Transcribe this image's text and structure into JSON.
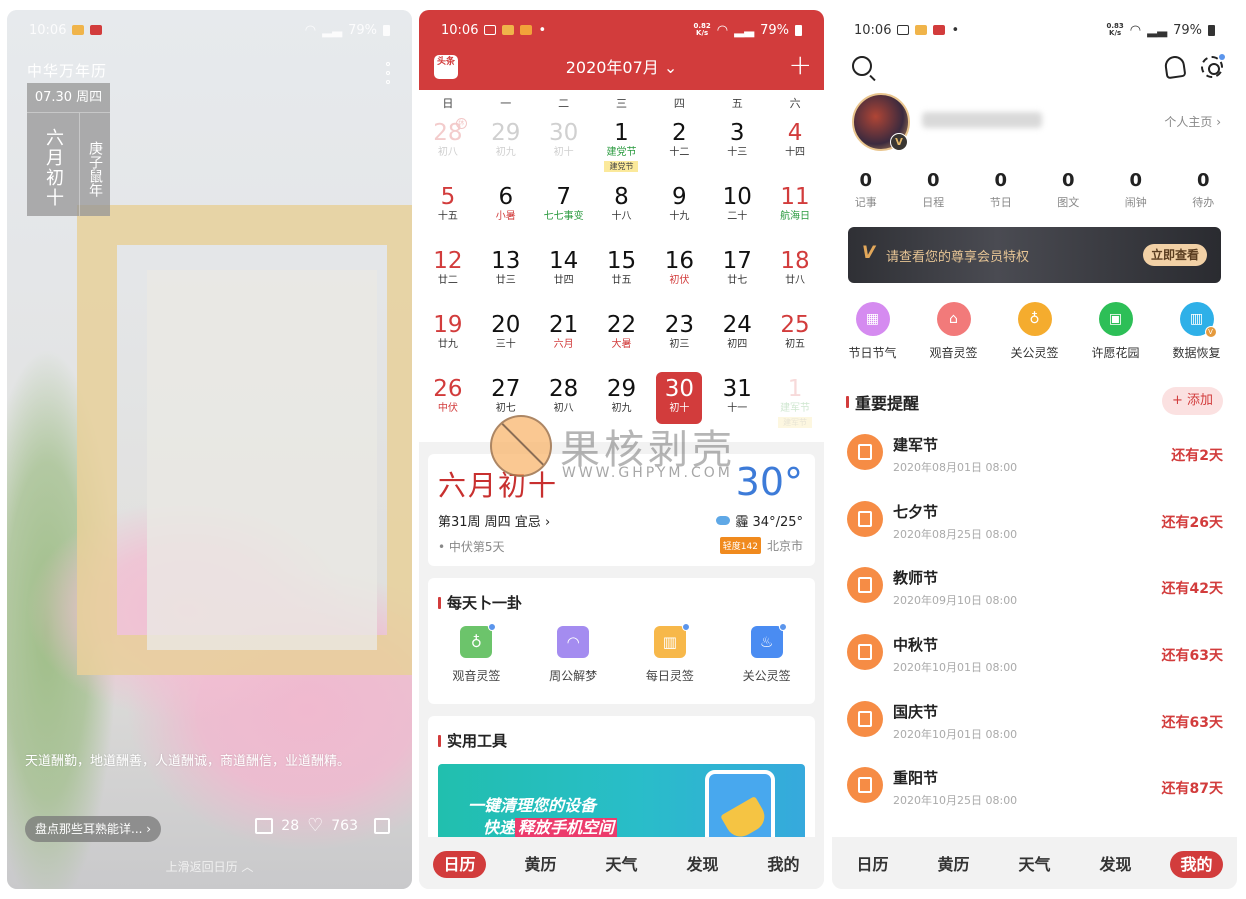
{
  "screen1": {
    "status": {
      "time": "10:06",
      "battery": "79%"
    },
    "app_name": "中华万年历",
    "date_card": {
      "date": "07.30 周四",
      "lunar": "六月初十",
      "year": "庚子鼠年"
    },
    "quote": "天道酬勤，地道酬善，人道酬诚，商道酬信，业道酬精。",
    "article_link": "盘点那些耳熟能详... ›",
    "comments": "28",
    "likes": "763",
    "swipe_hint": "上滑返回日历 ︿"
  },
  "screen2": {
    "status": {
      "time": "10:06",
      "speed": "0.82\nK/s",
      "battery": "79%"
    },
    "logo": "头条",
    "month_title": "2020年07月 ⌄",
    "add_label": "+",
    "weekdays": [
      "日",
      "一",
      "二",
      "三",
      "四",
      "五",
      "六"
    ],
    "days": [
      {
        "num": "28",
        "sub": "初八",
        "cls": "other wk",
        "badge": "休"
      },
      {
        "num": "29",
        "sub": "初九",
        "cls": "other"
      },
      {
        "num": "30",
        "sub": "初十",
        "cls": "other"
      },
      {
        "num": "1",
        "sub": "建党节",
        "subcls": "green",
        "tag": "建党节"
      },
      {
        "num": "2",
        "sub": "十二"
      },
      {
        "num": "3",
        "sub": "十三"
      },
      {
        "num": "4",
        "sub": "十四",
        "cls": "wk"
      },
      {
        "num": "5",
        "sub": "十五",
        "cls": "wk"
      },
      {
        "num": "6",
        "sub": "小暑",
        "subcls": "red"
      },
      {
        "num": "7",
        "sub": "七七事变",
        "subcls": "green"
      },
      {
        "num": "8",
        "sub": "十八"
      },
      {
        "num": "9",
        "sub": "十九"
      },
      {
        "num": "10",
        "sub": "二十"
      },
      {
        "num": "11",
        "sub": "航海日",
        "cls": "wk",
        "subcls": "green"
      },
      {
        "num": "12",
        "sub": "廿二",
        "cls": "wk"
      },
      {
        "num": "13",
        "sub": "廿三"
      },
      {
        "num": "14",
        "sub": "廿四"
      },
      {
        "num": "15",
        "sub": "廿五"
      },
      {
        "num": "16",
        "sub": "初伏",
        "subcls": "red"
      },
      {
        "num": "17",
        "sub": "廿七"
      },
      {
        "num": "18",
        "sub": "廿八",
        "cls": "wk"
      },
      {
        "num": "19",
        "sub": "廿九",
        "cls": "wk"
      },
      {
        "num": "20",
        "sub": "三十"
      },
      {
        "num": "21",
        "sub": "六月",
        "subcls": "red"
      },
      {
        "num": "22",
        "sub": "大暑",
        "subcls": "red"
      },
      {
        "num": "23",
        "sub": "初三"
      },
      {
        "num": "24",
        "sub": "初四"
      },
      {
        "num": "25",
        "sub": "初五",
        "cls": "wk"
      },
      {
        "num": "26",
        "sub": "中伏",
        "cls": "wk",
        "subcls": "red"
      },
      {
        "num": "27",
        "sub": "初七"
      },
      {
        "num": "28",
        "sub": "初八"
      },
      {
        "num": "29",
        "sub": "初九"
      },
      {
        "num": "30",
        "sub": "初十",
        "cls": "today"
      },
      {
        "num": "31",
        "sub": "十一"
      },
      {
        "num": "1",
        "sub": "建军节",
        "cls": "other faint",
        "tag": "建军节"
      }
    ],
    "lunar_card": {
      "lunar_date": "六月初十",
      "temperature": "30°",
      "week_info": "第31周 周四 宜忌 ›",
      "weather": "霾 34°/25°",
      "fu_info": "• 中伏第5天",
      "aqi": "轻度142",
      "city": "北京市"
    },
    "divination": {
      "title": "每天卜一卦",
      "items": [
        {
          "label": "观音灵签",
          "color": "#6cc46b",
          "glyph": "♁"
        },
        {
          "label": "周公解梦",
          "color": "#a48cf0",
          "glyph": "◠"
        },
        {
          "label": "每日灵签",
          "color": "#f7b84a",
          "glyph": "▥"
        },
        {
          "label": "关公灵签",
          "color": "#4a8cf2",
          "glyph": "♨"
        }
      ]
    },
    "tools": {
      "title": "实用工具",
      "banner_line1": "一键清理您的设备",
      "banner_line2_a": "快速",
      "banner_line2_b": "释放手机空间"
    },
    "tabs": [
      "日历",
      "黄历",
      "天气",
      "发现",
      "我的"
    ],
    "active_tab": 0
  },
  "watermark": {
    "text": "果核剥壳",
    "url": "WWW.GHPYM.COM"
  },
  "screen3": {
    "status": {
      "time": "10:06",
      "speed": "0.83\nK/s",
      "battery": "79%"
    },
    "homepage_link": "个人主页 ›",
    "vip_badge": "V",
    "counters": [
      {
        "value": "0",
        "label": "记事"
      },
      {
        "value": "0",
        "label": "日程"
      },
      {
        "value": "0",
        "label": "节日"
      },
      {
        "value": "0",
        "label": "图文"
      },
      {
        "value": "0",
        "label": "闹钟"
      },
      {
        "value": "0",
        "label": "待办"
      }
    ],
    "vip_banner": {
      "icon": "V",
      "text": "请查看您的尊享会员特权",
      "button": "立即查看"
    },
    "quick_actions": [
      {
        "label": "节日节气",
        "color": "#d58bf0",
        "glyph": "▦"
      },
      {
        "label": "观音灵签",
        "color": "#f27a7a",
        "glyph": "⌂"
      },
      {
        "label": "关公灵签",
        "color": "#f5ac2e",
        "glyph": "♁"
      },
      {
        "label": "许愿花园",
        "color": "#2dbf57",
        "glyph": "▣"
      },
      {
        "label": "数据恢复",
        "color": "#2eb0e8",
        "glyph": "▥"
      }
    ],
    "reminders_title": "重要提醒",
    "add_button": "+ 添加",
    "reminders": [
      {
        "name": "建军节",
        "date": "2020年08月01日  08:00",
        "remaining": "还有2天"
      },
      {
        "name": "七夕节",
        "date": "2020年08月25日  08:00",
        "remaining": "还有26天"
      },
      {
        "name": "教师节",
        "date": "2020年09月10日  08:00",
        "remaining": "还有42天"
      },
      {
        "name": "中秋节",
        "date": "2020年10月01日  08:00",
        "remaining": "还有63天"
      },
      {
        "name": "国庆节",
        "date": "2020年10月01日  08:00",
        "remaining": "还有63天"
      },
      {
        "name": "重阳节",
        "date": "2020年10月25日  08:00",
        "remaining": "还有87天"
      }
    ],
    "tabs": [
      "日历",
      "黄历",
      "天气",
      "发现",
      "我的"
    ],
    "active_tab": 4
  },
  "colors": {
    "brand_red": "#d23c3c",
    "reminder_orange": "#f68c45",
    "temp_blue": "#3d7bd8"
  }
}
